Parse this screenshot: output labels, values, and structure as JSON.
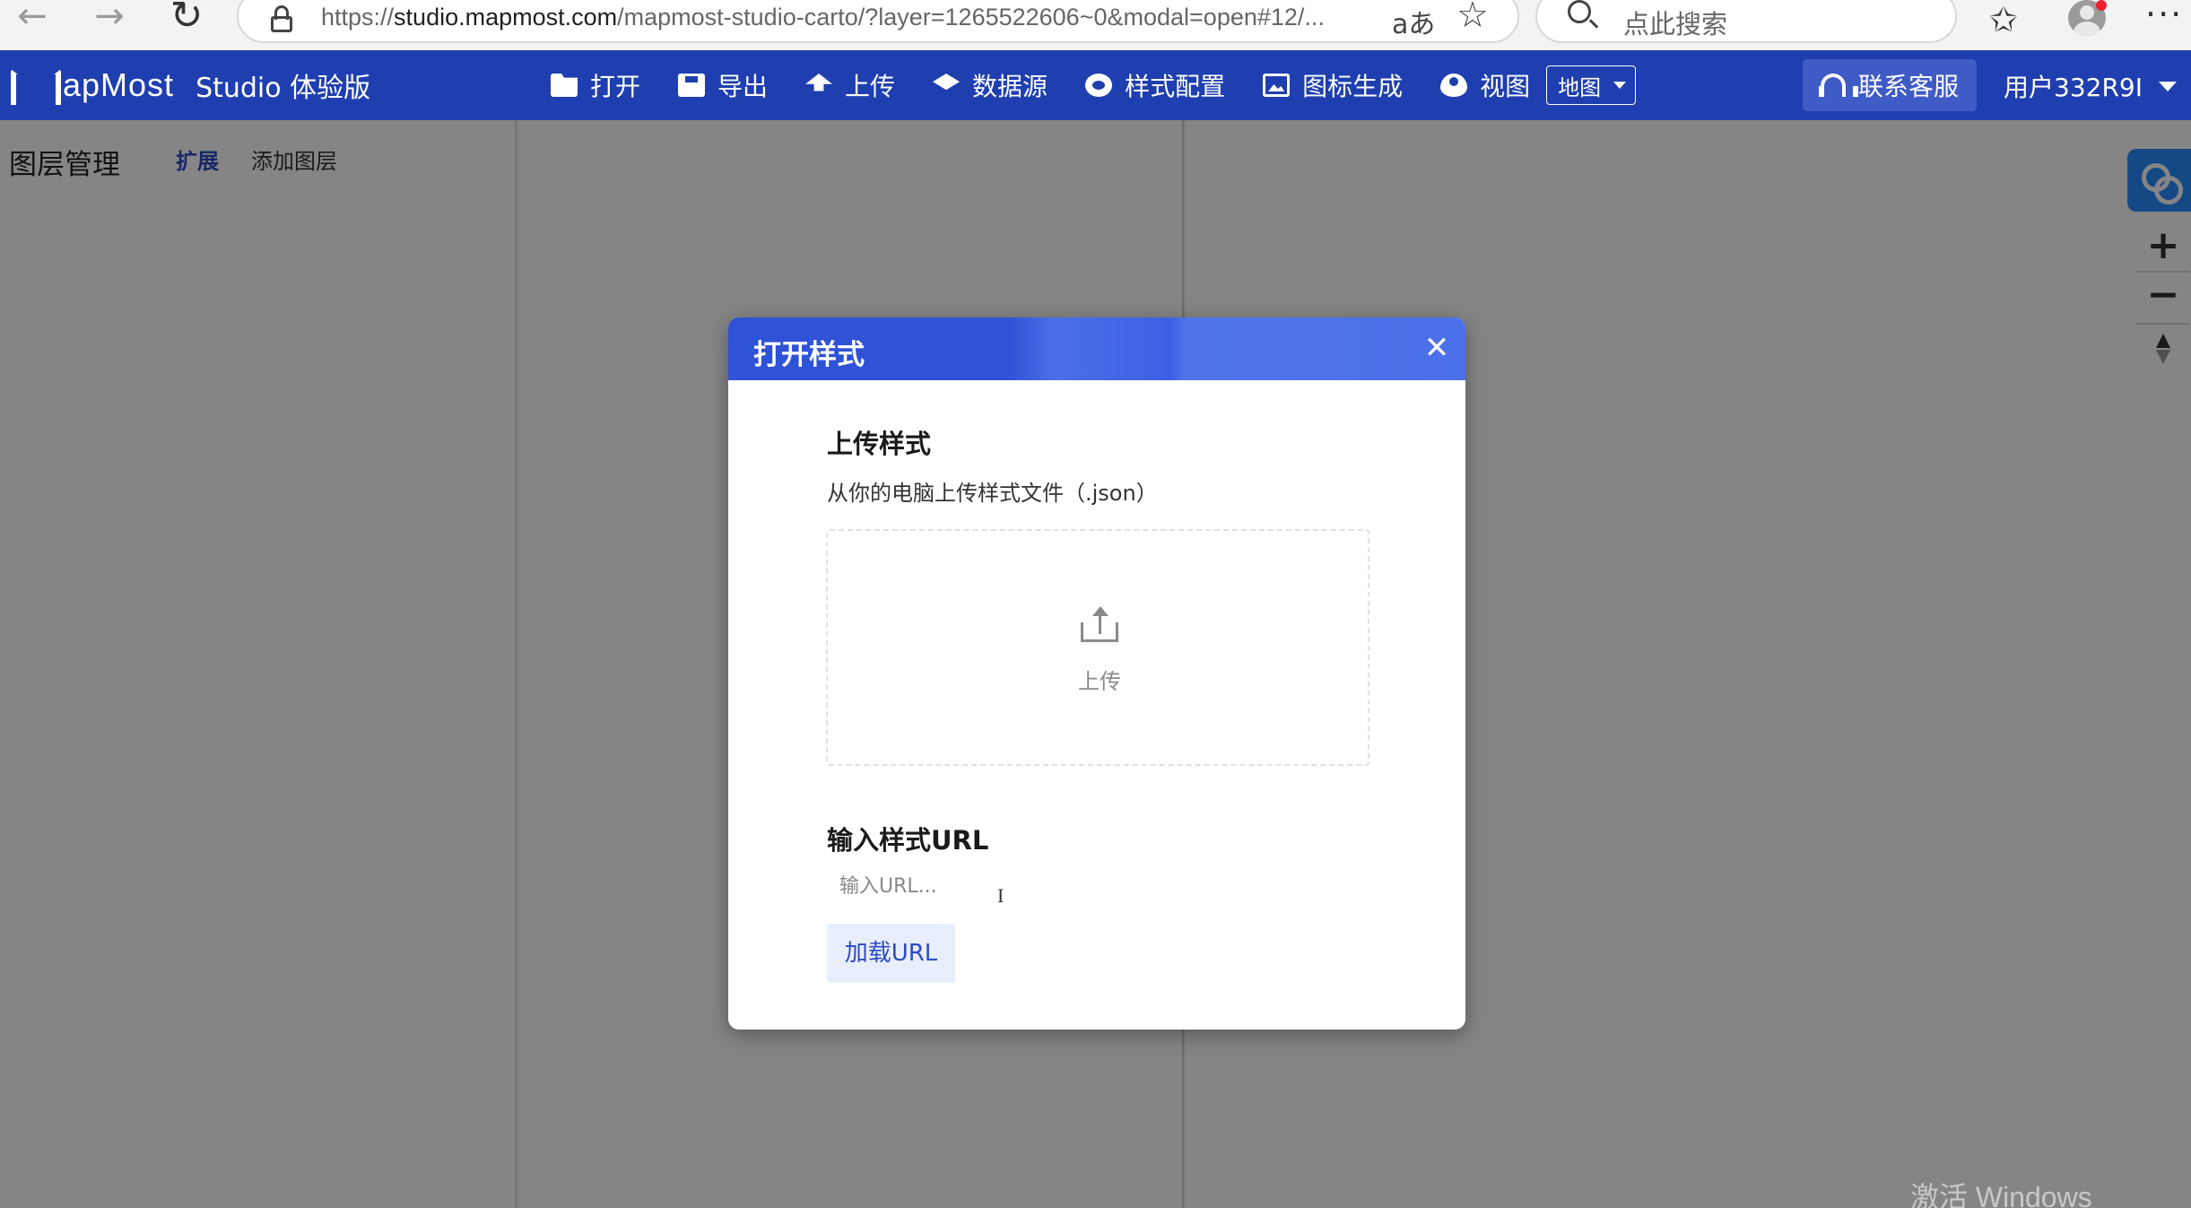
{
  "browser": {
    "url_prefix": "https://",
    "url_host": "studio.mapmost.com",
    "url_path": "/mapmost-studio-carto/?layer=1265522606~0&modal=open#12/...",
    "read_aloud_label": "aあ",
    "search_placeholder": "点此搜索"
  },
  "header": {
    "logo_text": "apMost",
    "logo_sub": "Studio 体验版",
    "tools": [
      {
        "label": "打开",
        "icon": "folder-open-icon"
      },
      {
        "label": "导出",
        "icon": "save-icon"
      },
      {
        "label": "上传",
        "icon": "upload-icon"
      },
      {
        "label": "数据源",
        "icon": "layers-icon"
      },
      {
        "label": "样式配置",
        "icon": "gear-icon"
      },
      {
        "label": "图标生成",
        "icon": "image-icon"
      },
      {
        "label": "视图",
        "icon": "eye-icon"
      }
    ],
    "view_select_value": "地图",
    "contact_label": "联系客服",
    "user_label": "用户332R9I"
  },
  "left_panel": {
    "title": "图层管理",
    "tab_expand": "扩展",
    "tab_add_layer": "添加图层"
  },
  "modal": {
    "title": "打开样式",
    "close_symbol": "✕",
    "upload_section_title": "上传样式",
    "upload_section_desc": "从你的电脑上传样式文件（.json）",
    "upload_zone_label": "上传",
    "url_section_title": "输入样式URL",
    "url_input_value": "",
    "url_input_placeholder": "输入URL...",
    "load_url_label": "加载URL"
  },
  "map_controls": {
    "zoom_in": "+",
    "zoom_out": "−"
  },
  "watermark": "激活 Windows",
  "colors": {
    "header_bg": "#1f3fb0",
    "modal_header": "#2f52d6",
    "accent": "#2d4bc4",
    "baidu_blue": "#2a8cff"
  }
}
